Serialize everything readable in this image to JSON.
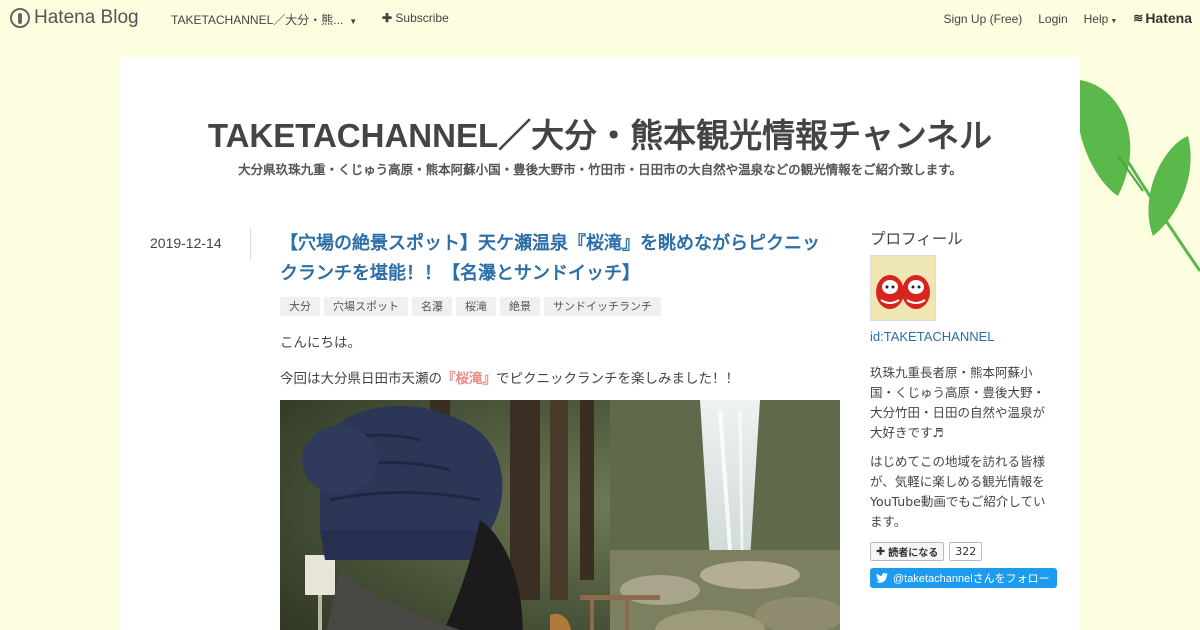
{
  "topbar": {
    "logo_text": "Hatena Blog",
    "blog_switcher": "TAKETACHANNEL／大分・熊...",
    "subscribe": "Subscribe",
    "signup": "Sign Up (Free)",
    "login": "Login",
    "help": "Help",
    "brand": "Hatena"
  },
  "header": {
    "title": "TAKETACHANNEL／大分・熊本観光情報チャンネル",
    "description": "大分県玖珠九重・くじゅう高原・熊本阿蘇小国・豊後大野市・竹田市・日田市の大自然や温泉などの観光情報をご紹介致します。"
  },
  "entry": {
    "date": "2019-12-14",
    "title": "【穴場の絶景スポット】天ケ瀬温泉『桜滝』を眺めながらピクニックランチを堪能！！【名瀑とサンドイッチ】",
    "tags": [
      "大分",
      "穴場スポット",
      "名瀑",
      "桜滝",
      "絶景",
      "サンドイッチランチ"
    ],
    "paragraph1": "こんにちは。",
    "paragraph2_before": "今回は大分県日田市天瀬の",
    "paragraph2_highlight": "『桜滝』",
    "paragraph2_after": "でピクニックランチを楽しみました！！"
  },
  "sidebar": {
    "profile_heading": "プロフィール",
    "profile_id": "id:TAKETACHANNEL",
    "bio1": "玖珠九重長者原・熊本阿蘇小国・くじゅう高原・豊後大野・大分竹田・日田の自然や温泉が大好きです♬",
    "bio2": "はじめてこの地域を訪れる皆様が、気軽に楽しめる観光情報をYouTube動画でもご紹介しています。",
    "reader_button": "読者になる",
    "reader_count": "322",
    "twitter_button": "@taketachannelさんをフォロー"
  },
  "colors": {
    "page_bg": "#fdfde0",
    "link": "#2c6ea8",
    "highlight": "#e98a8a",
    "leaf": "#5bb84a",
    "twitter": "#1d9bf0"
  }
}
